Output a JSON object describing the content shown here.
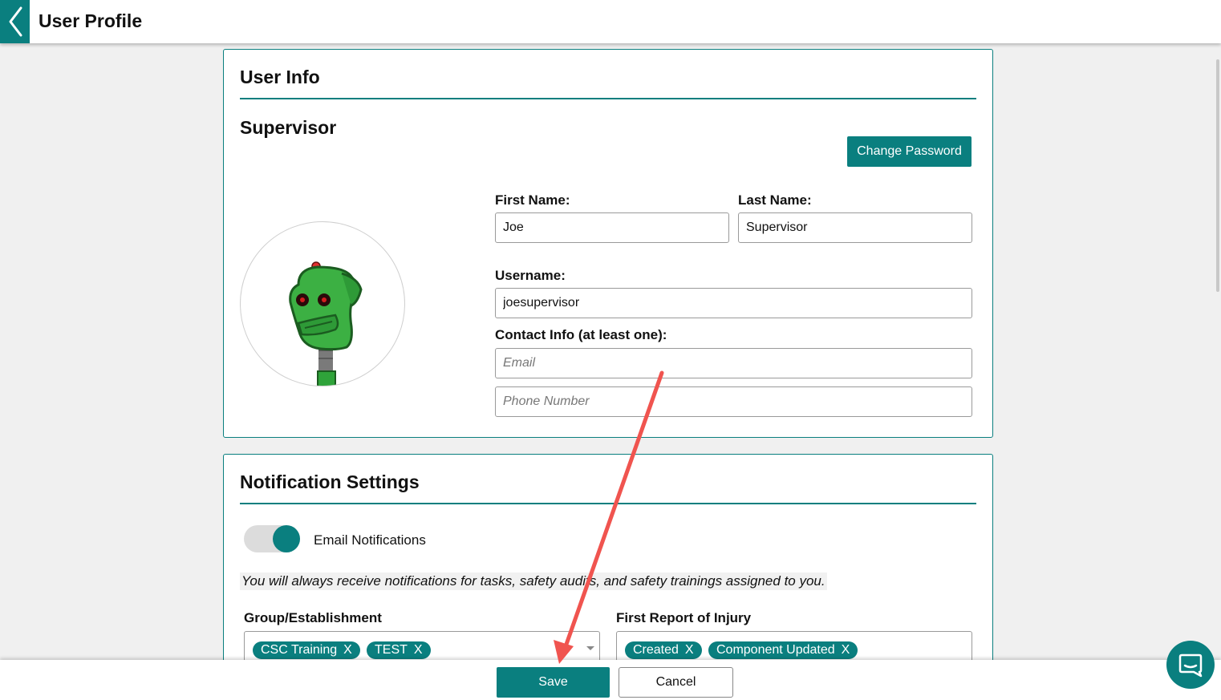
{
  "header": {
    "title": "User Profile",
    "back_icon": "chevron-left-icon"
  },
  "user_info": {
    "section_title": "User Info",
    "role": "Supervisor",
    "change_password_label": "Change Password",
    "avatar_icon": "robot-avatar-icon",
    "first_name": {
      "label": "First Name:",
      "value": "Joe"
    },
    "last_name": {
      "label": "Last Name:",
      "value": "Supervisor"
    },
    "username": {
      "label": "Username:",
      "value": "joesupervisor"
    },
    "contact": {
      "label": "Contact Info (at least one):",
      "email_placeholder": "Email",
      "email_value": "",
      "phone_placeholder": "Phone Number",
      "phone_value": ""
    }
  },
  "notifications": {
    "section_title": "Notification Settings",
    "email_toggle": {
      "label": "Email Notifications",
      "on": true
    },
    "notice": "You will always receive notifications for tasks, safety audits, and safety trainings assigned to you.",
    "group": {
      "label": "Group/Establishment",
      "tags": [
        "CSC Training",
        "TEST"
      ]
    },
    "injury": {
      "label": "First Report of Injury",
      "tags": [
        "Created",
        "Component Updated"
      ]
    },
    "tag_remove_symbol": "X"
  },
  "footer": {
    "save_label": "Save",
    "cancel_label": "Cancel"
  },
  "chat": {
    "icon": "chat-bubble-icon"
  },
  "colors": {
    "accent": "#0a7f7f",
    "annotation_arrow": "#f0544f",
    "background": "#f0f0f0"
  }
}
